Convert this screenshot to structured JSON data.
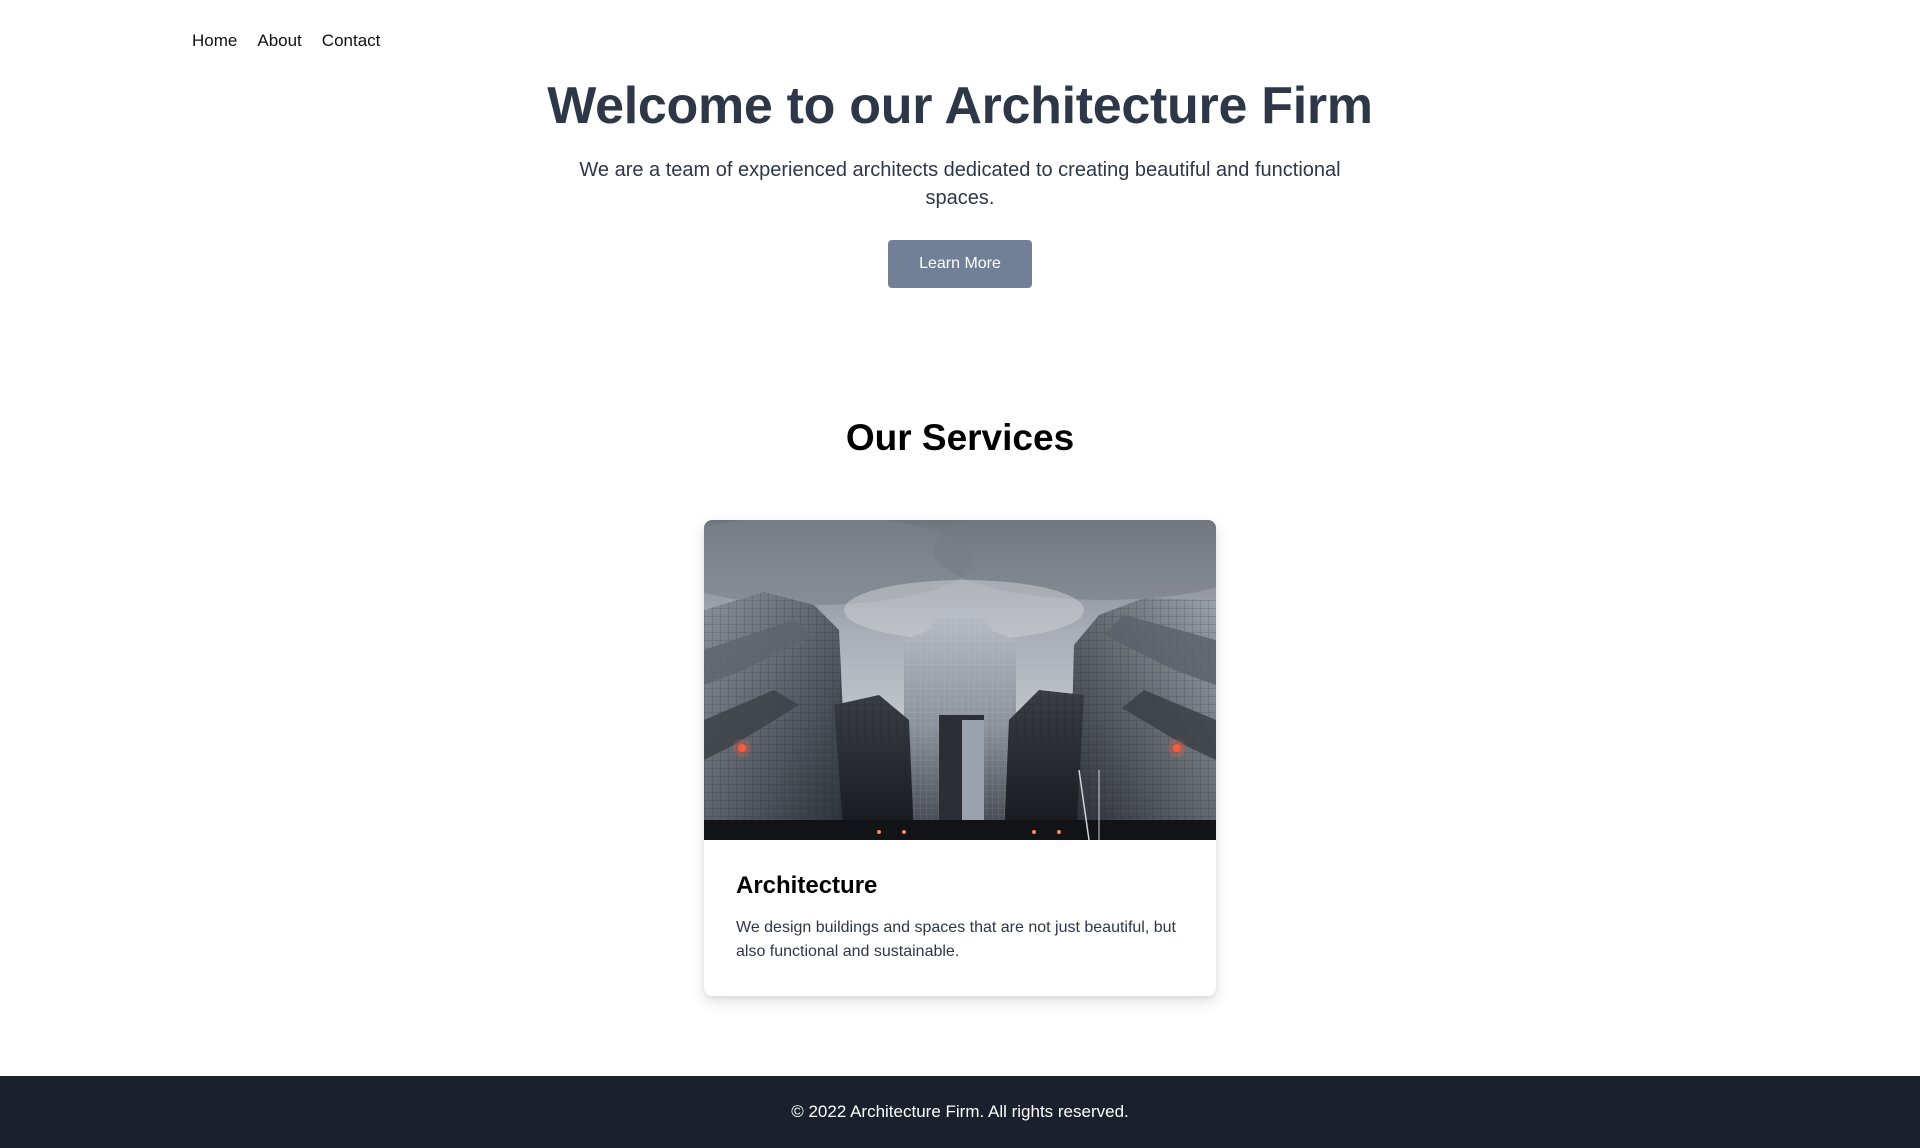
{
  "nav": {
    "items": [
      {
        "label": "Home"
      },
      {
        "label": "About"
      },
      {
        "label": "Contact"
      }
    ]
  },
  "hero": {
    "title": "Welcome to our Architecture Firm",
    "subtitle": "We are a team of experienced architects dedicated to creating beautiful and functional spaces.",
    "button_label": "Learn More"
  },
  "services": {
    "title": "Our Services",
    "cards": [
      {
        "title": "Architecture",
        "text": "We design buildings and spaces that are not just beautiful, but also functional and sustainable.",
        "image": "skyscrapers-photo"
      }
    ]
  },
  "footer": {
    "text": "© 2022 Architecture Firm. All rights reserved."
  },
  "colors": {
    "heading": "#2d3748",
    "button_bg": "#718096",
    "footer_bg": "#1a202c"
  }
}
